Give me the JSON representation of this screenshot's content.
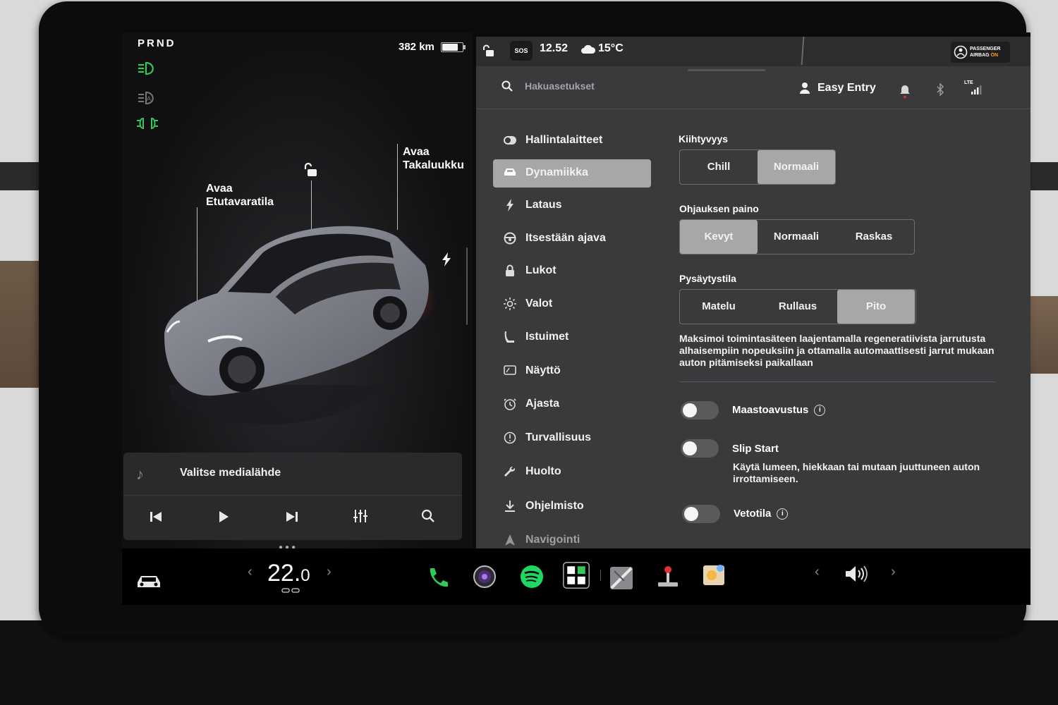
{
  "drive": {
    "prnd": "PRND",
    "range": "382 km",
    "battery_level": 0.8
  },
  "car": {
    "front_trunk_label": "Avaa\nEtutavaratila",
    "rear_trunk_label": "Avaa\nTakaluukku",
    "lock_icon": "unlock-icon",
    "charge_icon": "lightning-icon"
  },
  "media": {
    "source_label": "Valitse medialähde",
    "controls": [
      "previous-icon",
      "play-icon",
      "next-icon",
      "equalizer-icon",
      "search-icon"
    ]
  },
  "status_bar": {
    "time": "12.52",
    "temperature": "15°C",
    "sos": "SOS",
    "airbag_line1": "PASSENGER",
    "airbag_line2a": "AIRBAG ",
    "airbag_line2b": "ON"
  },
  "header": {
    "search_placeholder": "Hakuasetukset",
    "profile": "Easy Entry",
    "lte": "LTE"
  },
  "menu": [
    {
      "label": "Hallintalaitteet",
      "icon": "toggle-icon",
      "active": false
    },
    {
      "label": "Dynamiikka",
      "icon": "car-icon",
      "active": true
    },
    {
      "label": "Lataus",
      "icon": "lightning-icon",
      "active": false
    },
    {
      "label": "Itsestään ajava",
      "icon": "steering-wheel-icon",
      "active": false
    },
    {
      "label": "Lukot",
      "icon": "lock-icon",
      "active": false
    },
    {
      "label": "Valot",
      "icon": "sun-icon",
      "active": false
    },
    {
      "label": "Istuimet",
      "icon": "seat-icon",
      "active": false
    },
    {
      "label": "Näyttö",
      "icon": "display-icon",
      "active": false
    },
    {
      "label": "Ajasta",
      "icon": "clock-icon",
      "active": false
    },
    {
      "label": "Turvallisuus",
      "icon": "alert-icon",
      "active": false
    },
    {
      "label": "Huolto",
      "icon": "wrench-icon",
      "active": false
    },
    {
      "label": "Ohjelmisto",
      "icon": "download-icon",
      "active": false
    },
    {
      "label": "Navigointi",
      "icon": "navigation-icon",
      "active": false
    }
  ],
  "dynamics": {
    "acceleration": {
      "title": "Kiihtyvyys",
      "options": [
        "Chill",
        "Normaali"
      ],
      "selected": "Normaali"
    },
    "steering": {
      "title": "Ohjauksen paino",
      "options": [
        "Kevyt",
        "Normaali",
        "Raskas"
      ],
      "selected": "Kevyt"
    },
    "stopping": {
      "title": "Pysäytystila",
      "options": [
        "Matelu",
        "Rullaus",
        "Pito"
      ],
      "selected": "Pito",
      "description": "Maksimoi toimintasäteen laajentamalla regeneratiivista jarrutusta alhaisempiin nopeuksiin ja ottamalla automaattisesti jarrut mukaan auton pitämiseksi paikallaan"
    },
    "toggles": [
      {
        "label": "Maastoavustus",
        "on": false,
        "info": true
      },
      {
        "label": "Slip Start",
        "on": false,
        "info": false,
        "description": "Käytä lumeen, hiekkaan tai mutaan juuttuneen auton irrottamiseen."
      },
      {
        "label": "Vetotila",
        "on": false,
        "info": true
      }
    ]
  },
  "dock": {
    "temperature_whole": "22.",
    "temperature_decimal": "0",
    "apps": [
      "phone-icon",
      "camera-icon",
      "spotify-icon",
      "apps-icon",
      "map-app-icon",
      "joystick-icon",
      "photo-booth-icon"
    ],
    "volume_icon": "volume-icon"
  },
  "colors": {
    "accent_green": "#35c759",
    "active_bg": "#a7a7aa",
    "panel_bg": "#3a3a3c"
  }
}
